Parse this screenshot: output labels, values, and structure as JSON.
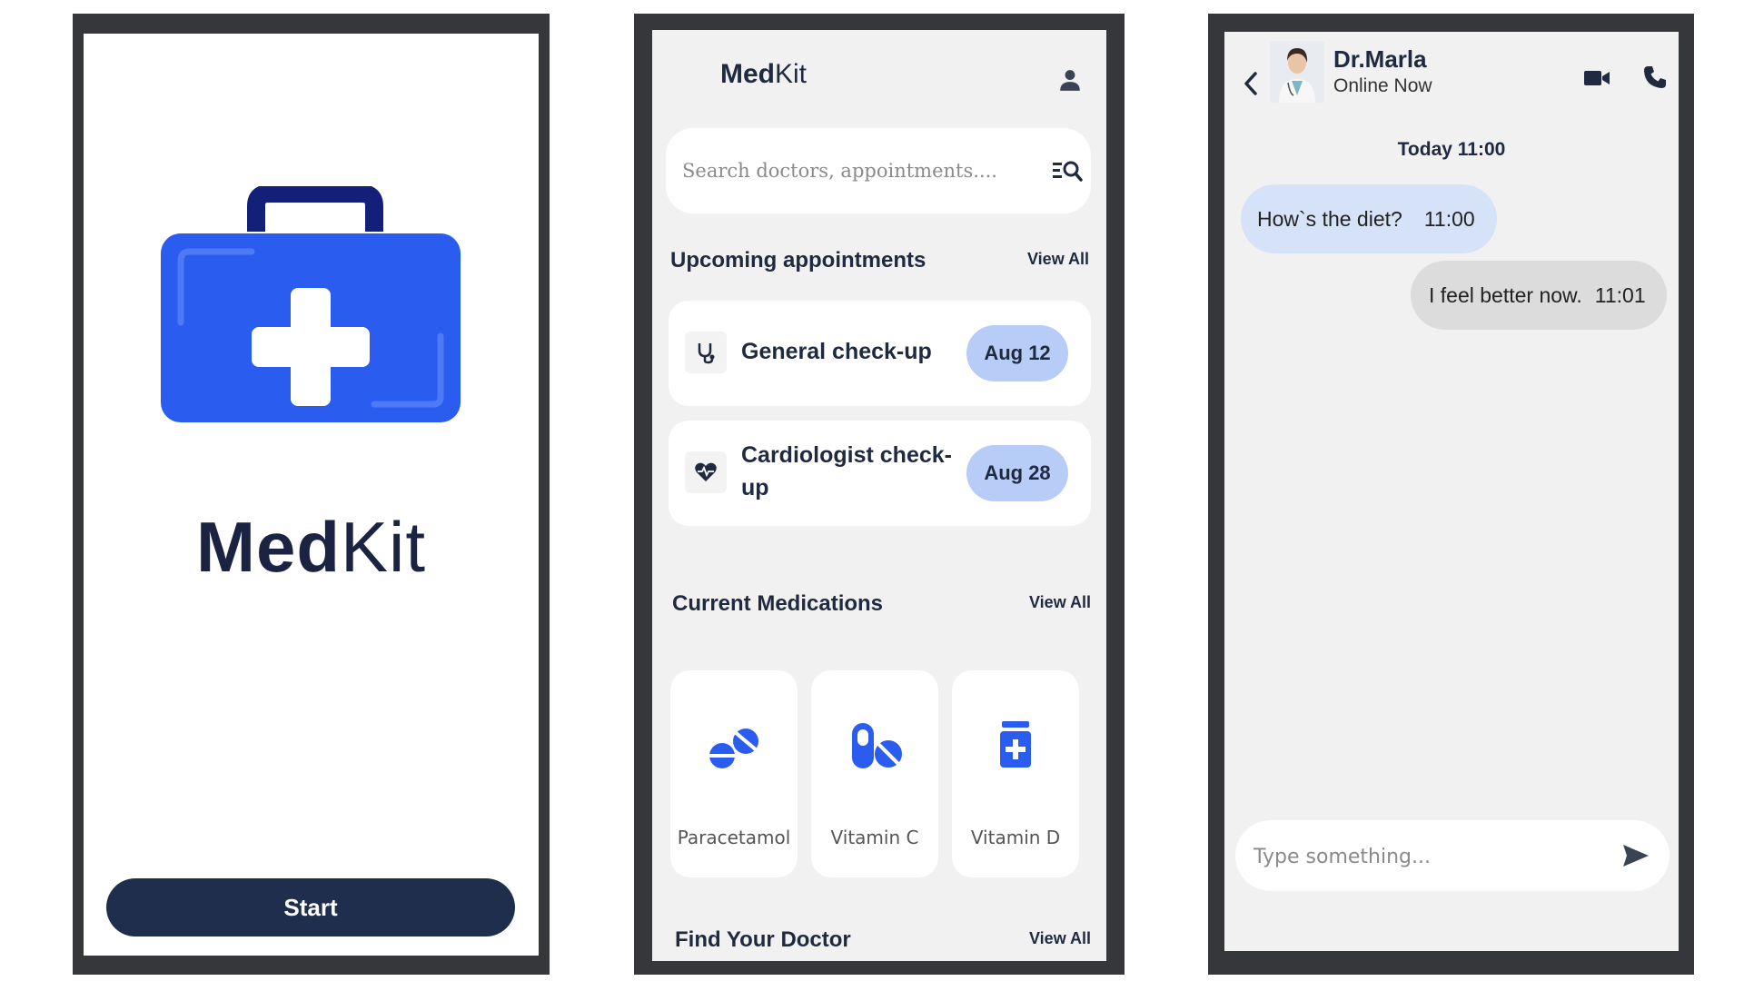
{
  "splash": {
    "brand_bold": "Med",
    "brand_rest": "Kit",
    "start_label": "Start"
  },
  "dashboard": {
    "app_bold": "Med",
    "app_rest": "Kit",
    "search_placeholder": "Search doctors, appointments....",
    "upcoming": {
      "title": "Upcoming appointments",
      "view_all": "View All",
      "items": [
        {
          "label": "General check-up",
          "date": "Aug 12",
          "icon": "stethoscope-icon"
        },
        {
          "label_line1": "Cardiologist check-",
          "label_line2": "up",
          "date": "Aug 28",
          "icon": "heartbeat-icon"
        }
      ]
    },
    "medications": {
      "title": "Current Medications",
      "view_all": "View All",
      "items": [
        {
          "name": "Paracetamol",
          "icon": "tablets-icon"
        },
        {
          "name": "Vitamin C",
          "icon": "pills-icon"
        },
        {
          "name": "Vitamin D",
          "icon": "medicine-bottle-icon"
        }
      ]
    },
    "find_doctor": {
      "title": "Find Your Doctor",
      "view_all": "View All"
    }
  },
  "chat": {
    "doctor_name": "Dr.Marla",
    "status": "Online Now",
    "day_stamp": "Today  11:00",
    "messages": [
      {
        "text": "How`s the diet?",
        "time": "11:00",
        "from": "doctor"
      },
      {
        "text": "I feel better now.",
        "time": "11:01",
        "from": "me"
      }
    ],
    "composer_placeholder": "Type something..."
  },
  "colors": {
    "accent_blue": "#2b5cf0",
    "navy": "#1f2e4d",
    "frame": "#35373b",
    "date_pill": "#b7ccf6",
    "incoming_bubble": "#d6e2f7",
    "outgoing_bubble": "#dcdcdc"
  }
}
